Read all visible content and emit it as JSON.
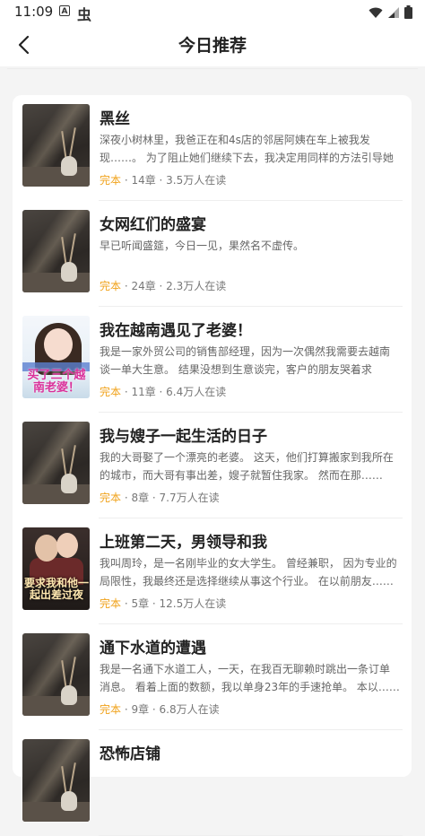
{
  "status_bar": {
    "time": "11:09",
    "notif_a": "A",
    "app_glyph": "虫"
  },
  "header": {
    "title": "今日推荐"
  },
  "books": [
    {
      "title": "黑丝",
      "desc": "深夜小树林里，我爸正在和4s店的邻居阿姨在车上被我发现……。 为了阻止她们继续下去，我决定用同样的方法引导她们……",
      "status": "完本",
      "meta": " · 14章 · 3.5万人在读",
      "cover": "still-life"
    },
    {
      "title": "女网红们的盛宴",
      "desc": "早已听闻盛筵，今日一见，果然名不虚传。",
      "status": "完本",
      "meta": " · 24章 · 2.3万人在读",
      "cover": "still-life"
    },
    {
      "title": "我在越南遇见了老婆！",
      "desc": "我是一家外贸公司的销售部经理，因为一次偶然我需要去越南谈一单大生意。 结果没想到生意谈完，客户的朋友哭着求我……",
      "status": "完本",
      "meta": " · 11章 · 6.4万人在读",
      "cover": "bride",
      "cover_text": "买了三个越南老婆！"
    },
    {
      "title": "我与嫂子一起生活的日子",
      "desc": "我的大哥娶了一个漂亮的老婆。 这天，他们打算搬家到我所在的城市，而大哥有事出差，嫂子就暂住我家。 然而在那……",
      "status": "完本",
      "meta": " · 8章 · 7.7万人在读",
      "cover": "still-life"
    },
    {
      "title": "上班第二天，男领导和我",
      "desc": "我叫周玲，是一名刚毕业的女大学生。 曾经兼职， 因为专业的局限性，我最终还是选择继续从事这个行业。 在以前朋友……",
      "status": "完本",
      "meta": " · 5章 · 12.5万人在读",
      "cover": "couple",
      "cover_text": "要求我和他一起出差过夜"
    },
    {
      "title": "通下水道的遭遇",
      "desc": "我是一名通下水道工人，一天，在我百无聊赖时跳出一条订单消息。 看着上面的数额，我以单身23年的手速抢单。 本以……",
      "status": "完本",
      "meta": " · 9章 · 6.8万人在读",
      "cover": "still-life"
    },
    {
      "title": "恐怖店铺",
      "desc": "",
      "status": "",
      "meta": "",
      "cover": "still-life"
    }
  ]
}
